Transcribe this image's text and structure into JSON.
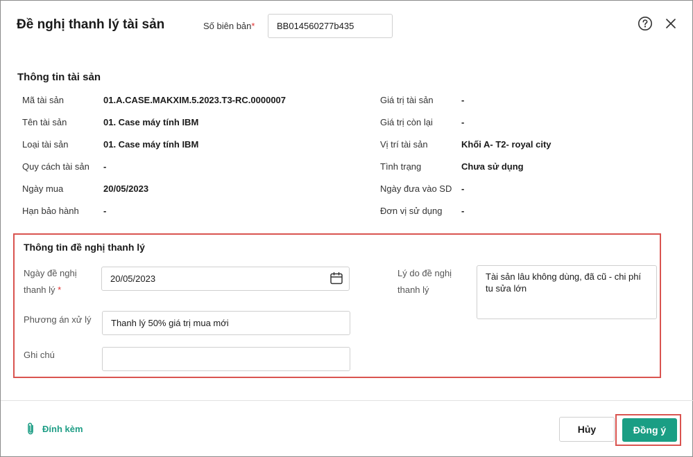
{
  "header": {
    "title": "Đề nghị thanh lý tài sản",
    "doc_number_label": "Số biên bản",
    "doc_number_required": "*",
    "doc_number_value": "BB014560277b435",
    "help_icon": "help-circle-icon",
    "close_icon": "close-icon"
  },
  "asset_info": {
    "section_title": "Thông tin tài sản",
    "left": [
      {
        "label": "Mã tài sản",
        "value": "01.A.CASE.MAKXIM.5.2023.T3-RC.0000007"
      },
      {
        "label": "Tên tài sản",
        "value": "01. Case máy tính IBM"
      },
      {
        "label": "Loại tài sản",
        "value": "01. Case máy tính IBM"
      },
      {
        "label": "Quy cách tài sản",
        "value": "-"
      },
      {
        "label": "Ngày mua",
        "value": "20/05/2023"
      },
      {
        "label": "Hạn bảo hành",
        "value": "-"
      }
    ],
    "right": [
      {
        "label": "Giá trị tài sản",
        "value": "-"
      },
      {
        "label": "Giá trị còn lại",
        "value": "-"
      },
      {
        "label": "Vị trí tài sản",
        "value": "Khối A- T2- royal city"
      },
      {
        "label": "Tình trạng",
        "value": "Chưa sử dụng"
      },
      {
        "label": "Ngày đưa vào SD",
        "value": "-"
      },
      {
        "label": "Đơn vị sử dụng",
        "value": "-"
      }
    ]
  },
  "proposal": {
    "section_title": "Thông tin đề nghị thanh lý",
    "date_label_line1": "Ngày đề nghị",
    "date_label_line2": "thanh lý",
    "date_required": "*",
    "date_value": "20/05/2023",
    "calendar_icon": "calendar-icon",
    "plan_label": "Phương án xử lý",
    "plan_value": "Thanh lý 50% giá trị mua mới",
    "note_label": "Ghi chú",
    "note_value": "",
    "reason_label_line1": "Lý do đề nghị",
    "reason_label_line2": "thanh lý",
    "reason_value": "Tài sản lâu không dùng, đã cũ - chi phí tu sửa lớn"
  },
  "footer": {
    "attach_label": "Đính kèm",
    "attach_icon": "paperclip-icon",
    "cancel_label": "Hủy",
    "confirm_label": "Đồng ý",
    "accent_color": "#1a9e84",
    "highlight_color": "#d9534f"
  }
}
